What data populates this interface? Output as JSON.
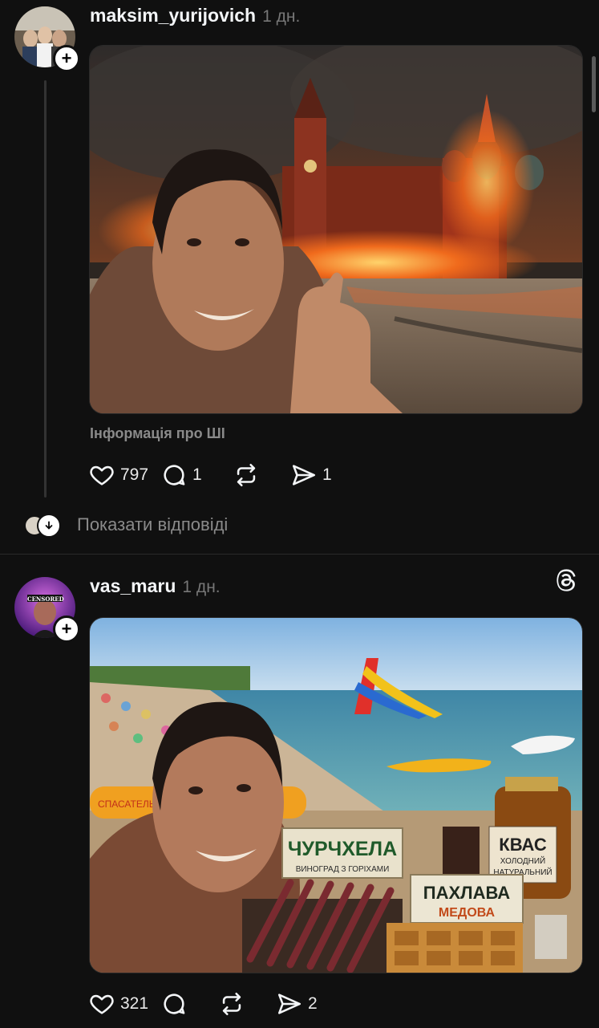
{
  "posts": [
    {
      "username": "maksim_yurijovich",
      "time": "1 дн.",
      "ai_info": "Інформація про ШІ",
      "stats": {
        "likes": "797",
        "comments": "1",
        "reposts": "",
        "shares": "1"
      },
      "show_replies": "Показати відповіді",
      "image_desc": "selfie-burning-kremlin"
    },
    {
      "username": "vas_maru",
      "time": "1 дн.",
      "avatar_badge": "CENSORED",
      "stats": {
        "likes": "321",
        "comments": "",
        "reposts": "",
        "shares": "2"
      },
      "image_desc": "selfie-beach-kvas",
      "signs": {
        "churchkhela_title": "ЧУРЧХЕЛА",
        "churchkhela_sub": "ВИНОГРАД З ГОРІХАМИ",
        "kvas_title": "КВАС",
        "kvas_line1": "ХОЛОДНИЙ",
        "kvas_line2": "НАТУРАЛЬНИЙ",
        "pakhlava_title": "ПАХЛАВА",
        "pakhlava_sub": "МЕДОВА",
        "ring_text": "СПАСАТЕЛЬ"
      }
    }
  ],
  "colors": {
    "background": "#101010",
    "secondary_text": "#8a8a8a",
    "divider": "#2a2a2a"
  },
  "icons": [
    "heart-icon",
    "comment-icon",
    "repost-icon",
    "share-icon",
    "threads-logo-icon",
    "plus-icon",
    "chevron-down-icon"
  ]
}
